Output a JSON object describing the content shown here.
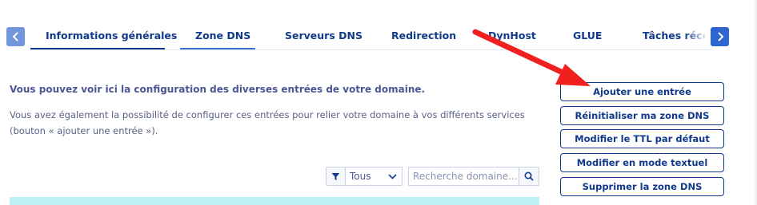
{
  "tabs": [
    {
      "label": "Informations générales"
    },
    {
      "label": "Zone DNS"
    },
    {
      "label": "Serveurs DNS"
    },
    {
      "label": "Redirection"
    },
    {
      "label": "DynHost"
    },
    {
      "label": "GLUE"
    },
    {
      "label": "Tâches récent"
    }
  ],
  "intro": {
    "title": "Vous pouvez voir ici la configuration des diverses entrées de votre domaine.",
    "body": "Vous avez également la possibilité de configurer ces entrées pour relier votre domaine à vos différents services (bouton « ajouter une entrée »)."
  },
  "actions": [
    {
      "label": "Ajouter une entrée"
    },
    {
      "label": "Réinitialiser ma zone DNS"
    },
    {
      "label": "Modifier le TTL par défaut"
    },
    {
      "label": "Modifier en mode textuel"
    },
    {
      "label": "Supprimer la zone DNS"
    }
  ],
  "filter": {
    "selected": "Tous"
  },
  "search": {
    "placeholder": "Recherche domaine..."
  },
  "colors": {
    "primary": "#113a8c",
    "accent_button": "#2e65d1",
    "annotation_arrow": "#f0201f",
    "table_header": "#bef1f6"
  },
  "icons": {
    "tab_prev": "chevron-left-icon",
    "tab_next": "chevron-right-icon",
    "filter": "filter-icon",
    "dropdown": "chevron-down-icon",
    "search": "search-icon"
  }
}
